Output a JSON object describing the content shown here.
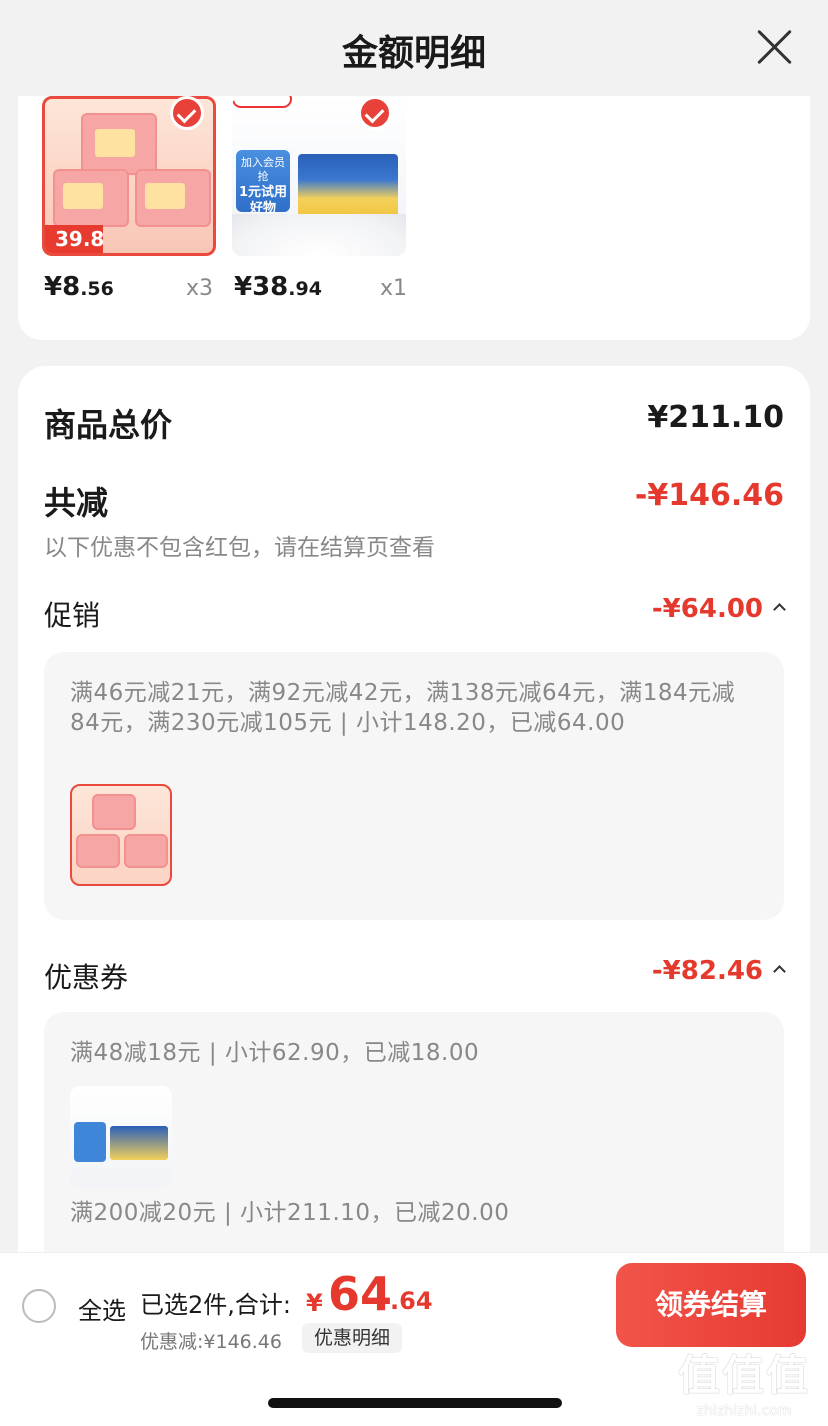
{
  "header": {
    "title": "金额明细"
  },
  "products": [
    {
      "price_int": "¥8",
      "price_dec": ".56",
      "qty": "x3",
      "badge_price": "39.8"
    },
    {
      "price_int": "¥38",
      "price_dec": ".94",
      "qty": "x1",
      "badge_line1": "加入会员抢",
      "badge_line2": "1元试用",
      "badge_line3": "好物"
    }
  ],
  "summary": {
    "total_label": "商品总价",
    "total_value": "¥211.10",
    "reduce_label": "共减",
    "reduce_value": "-¥146.46",
    "reduce_note": "以下优惠不包含红包，请在结算页查看",
    "promo_label": "促销",
    "promo_value": "-¥64.00",
    "promo_text": "满46元减21元，满92元减42元，满138元减64元，满184元减84元，满230元减105元 | 小计148.20，已减64.00",
    "coupon_label": "优惠券",
    "coupon_value": "-¥82.46",
    "coupon_text_1": "满48减18元 | 小计62.90，已减18.00",
    "coupon_text_2": "满200减20元 | 小计211.10，已减20.00"
  },
  "bottom": {
    "select_all": "全选",
    "selected_info": "已选2件,合计:",
    "total_yen": "¥",
    "total_int": "64",
    "total_dec": ".64",
    "discount": "优惠减:¥146.46",
    "detail_chip": "优惠明细",
    "checkout": "领券结算"
  },
  "watermark": {
    "line1": "值值值",
    "line2": "zhizhizhi.com"
  },
  "colors": {
    "accent": "#e6392e",
    "background": "#f2f2f2"
  }
}
